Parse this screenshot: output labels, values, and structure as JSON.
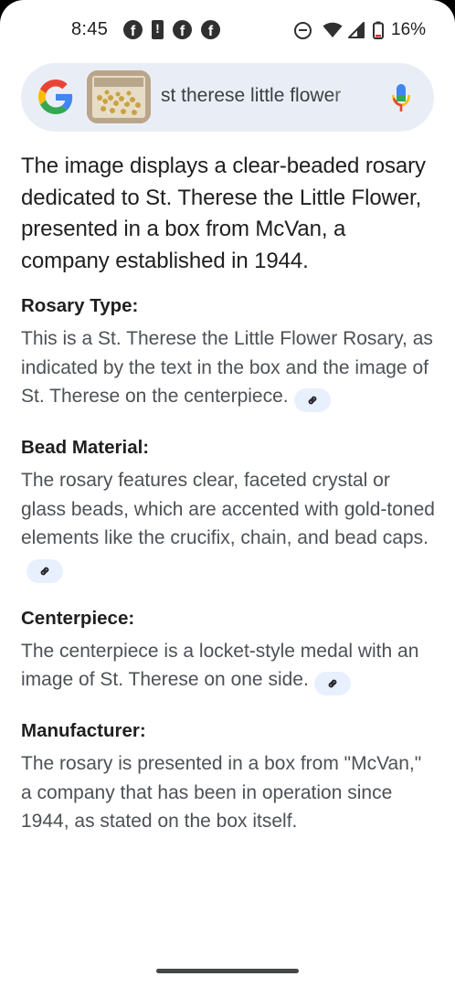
{
  "status_bar": {
    "time": "8:45",
    "battery_percent": "16%",
    "notification_icons": [
      "facebook-icon",
      "alert-icon",
      "facebook-icon",
      "facebook-messenger-icon"
    ],
    "system_icons": [
      "do-not-disturb-icon",
      "wifi-icon",
      "cell-signal-icon",
      "battery-icon"
    ]
  },
  "search": {
    "query": "st therese little flower",
    "icons": [
      "google-logo",
      "image-thumbnail",
      "mic-icon"
    ]
  },
  "overview": {
    "summary": "The image displays a clear-beaded rosary dedicated to St. Therese the Little Flower, presented in a box from McVan, a company established in 1944.",
    "sections": [
      {
        "title": "Rosary Type:",
        "body": "This is a St. Therese the Little Flower Rosary, as indicated by the text in the box and the image of St. Therese on the centerpiece."
      },
      {
        "title": "Bead Material:",
        "body": "The rosary features clear, faceted crystal or glass beads, which are accented with gold-toned elements like the crucifix, chain, and bead caps."
      },
      {
        "title": "Centerpiece:",
        "body": "The centerpiece is a locket-style medal with an image of St. Therese on one side."
      },
      {
        "title": "Manufacturer:",
        "body": "The rosary is presented in a box from \"McVan,\" a company that has been in operation since 1944, as stated on the box itself."
      }
    ]
  },
  "colors": {
    "search_bar_bg": "#e9eef6",
    "link_chip_bg": "#e8f0fe",
    "body_text": "#4d5156",
    "heading_text": "#1f1f1f"
  }
}
